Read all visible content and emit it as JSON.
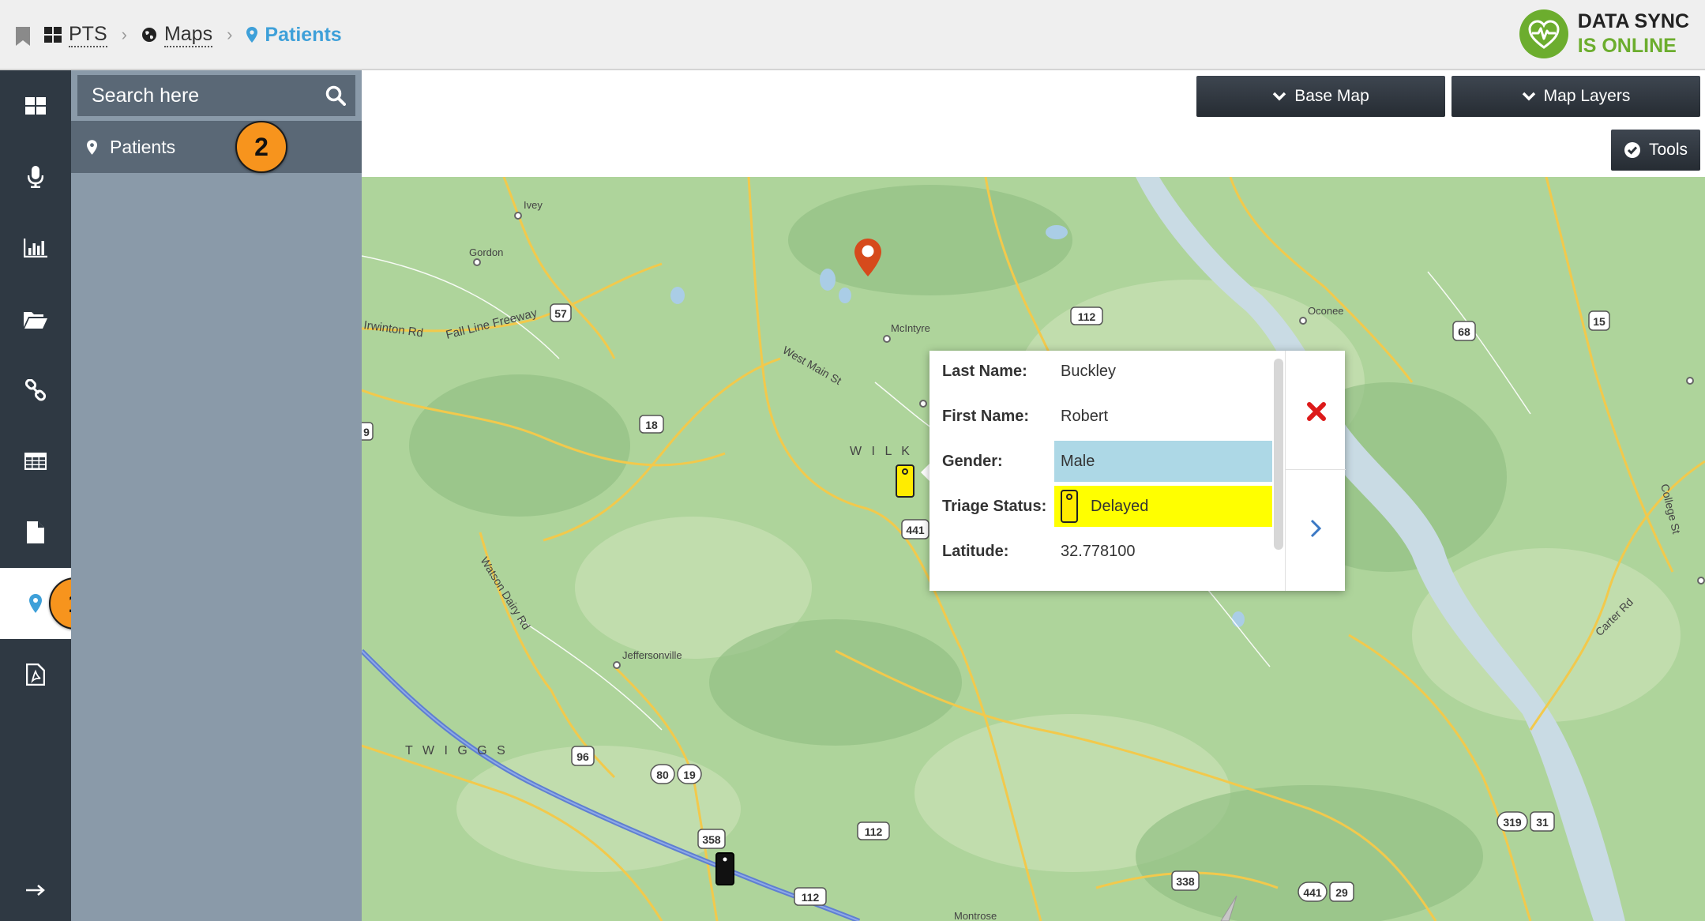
{
  "header": {
    "breadcrumb": [
      {
        "label": "PTS",
        "icon": "grid-icon"
      },
      {
        "label": "Maps",
        "icon": "globe-icon"
      },
      {
        "label": "Patients",
        "icon": "map-marker-icon"
      }
    ],
    "sync_line1": "DATA SYNC",
    "sync_line2": "IS ONLINE",
    "sync_color": "#6cad2e"
  },
  "rail": {
    "items": [
      {
        "name": "dashboard-icon"
      },
      {
        "name": "microphone-icon"
      },
      {
        "name": "bar-chart-icon"
      },
      {
        "name": "folder-open-icon"
      },
      {
        "name": "link-icon"
      },
      {
        "name": "table-icon"
      },
      {
        "name": "document-icon"
      },
      {
        "name": "map-marker-icon",
        "active": true,
        "badge": "1"
      },
      {
        "name": "pdf-icon"
      }
    ],
    "collapse_icon": "arrow-right-icon"
  },
  "panel": {
    "search_placeholder": "Search here",
    "item_label": "Patients",
    "item_badge": "2"
  },
  "toolbar": {
    "base_map": "Base Map",
    "map_layers": "Map Layers",
    "tools": "Tools"
  },
  "map": {
    "labels": [
      "Ivey",
      "Gordon",
      "McIntyre",
      "Oconee",
      "Irwinton Rd",
      "Fall Line Freeway",
      "West Main St",
      "W I L K",
      "Watson Dairy Rd",
      "Jeffersonville",
      "T W I G G S",
      "College St",
      "Carter Rd",
      "Montrose"
    ],
    "shields": [
      "57",
      "112",
      "68",
      "15",
      "18",
      "9",
      "441",
      "96",
      "80",
      "19",
      "358",
      "112",
      "112",
      "338",
      "441",
      "29",
      "319",
      "31"
    ]
  },
  "popup": {
    "rows": [
      {
        "label": "Last Name:",
        "value": "Buckley"
      },
      {
        "label": "First Name:",
        "value": "Robert"
      },
      {
        "label": "Gender:",
        "value": "Male"
      },
      {
        "label": "Triage Status:",
        "value": "Delayed"
      },
      {
        "label": "Latitude:",
        "value": "32.778100"
      }
    ],
    "gender_color": "#add8e6",
    "triage_color": "#ffff00"
  }
}
